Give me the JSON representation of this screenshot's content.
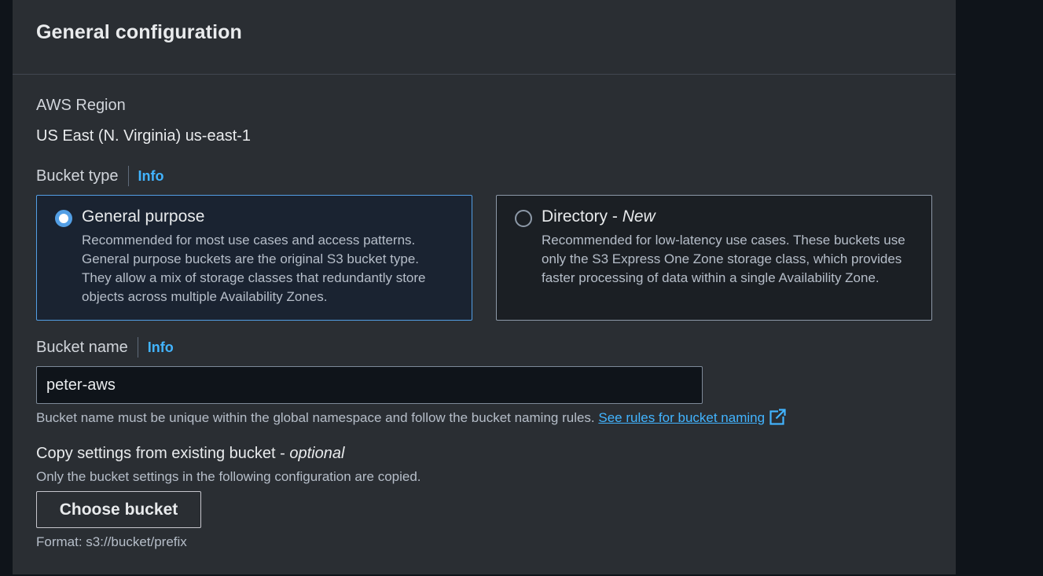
{
  "section": {
    "title": "General configuration"
  },
  "region": {
    "label": "AWS Region",
    "value": "US East (N. Virginia) us-east-1"
  },
  "bucket_type": {
    "label": "Bucket type",
    "info": "Info",
    "options": [
      {
        "title": "General purpose",
        "tag": "",
        "description": "Recommended for most use cases and access patterns. General purpose buckets are the original S3 bucket type. They allow a mix of storage classes that redundantly store objects across multiple Availability Zones.",
        "selected": true
      },
      {
        "title": "Directory - ",
        "tag": "New",
        "description": "Recommended for low-latency use cases. These buckets use only the S3 Express One Zone storage class, which provides faster processing of data within a single Availability Zone.",
        "selected": false
      }
    ]
  },
  "bucket_name": {
    "label": "Bucket name",
    "info": "Info",
    "value": "peter-aws",
    "hint": "Bucket name must be unique within the global namespace and follow the bucket naming rules.",
    "rules_link": "See rules for bucket naming"
  },
  "copy_settings": {
    "label": "Copy settings from existing bucket - ",
    "label_suffix": "optional",
    "description": "Only the bucket settings in the following configuration are copied.",
    "button_label": "Choose bucket",
    "format_hint": "Format: s3://bucket/prefix"
  },
  "colors": {
    "panel_bg": "#2a2e33",
    "page_bg": "#0f141a",
    "accent": "#539fe5",
    "link": "#42b4ff"
  },
  "icons": {
    "external_link": "external-link-icon"
  }
}
